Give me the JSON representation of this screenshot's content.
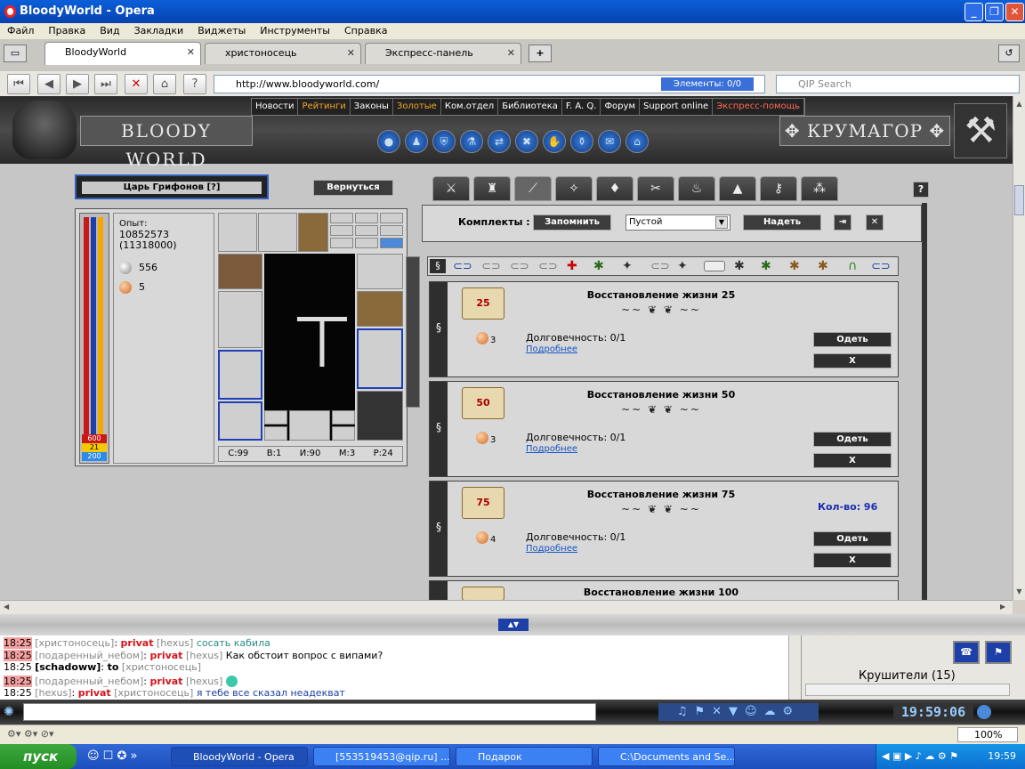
{
  "window": {
    "title": "BloodyWorld - Opera"
  },
  "menu": [
    "Файл",
    "Правка",
    "Вид",
    "Закладки",
    "Виджеты",
    "Инструменты",
    "Справка"
  ],
  "tabs": [
    {
      "label": "BloodyWorld"
    },
    {
      "label": "христоносець"
    },
    {
      "label": "Экспресс-панель"
    }
  ],
  "address": {
    "url": "http://www.bloodyworld.com/",
    "elements_label": "Элементы:",
    "elements_count": "0/0",
    "search_placeholder": "QIP Search"
  },
  "game": {
    "nav": [
      "Новости",
      "Рейтинги",
      "Законы",
      "Золотые",
      "Ком.отдел",
      "Библиотека",
      "F. A. Q.",
      "Форум",
      "Support online",
      "Экспресс-помощь"
    ],
    "logo_text": "BLOODY WORLD",
    "city": "КРУМАГОР",
    "char_name": "Царь Грифонов [?]",
    "back_button": "Вернуться",
    "exp_label": "Опыт:",
    "exp_value": "10852573",
    "exp_next": "(11318000)",
    "silver": "556",
    "copper": "5",
    "bar_hp": "600",
    "bar_mp": "21",
    "bar_en": "200",
    "stats": [
      "С:99",
      "В:1",
      "И:90",
      "М:3",
      "Р:24"
    ],
    "sets_label": "Комплекты :",
    "remember_button": "Запомнить",
    "set_select": "Пустой",
    "wear_set_button": "Надеть",
    "items": [
      {
        "name": "Восстановление жизни 25",
        "badge": "25",
        "price": "3",
        "durability": "Долговечность: 0/1",
        "more": "Подробнее",
        "qty": "",
        "wear": "Одеть",
        "del": "X"
      },
      {
        "name": "Восстановление жизни 50",
        "badge": "50",
        "price": "3",
        "durability": "Долговечность: 0/1",
        "more": "Подробнее",
        "qty": "",
        "wear": "Одеть",
        "del": "X"
      },
      {
        "name": "Восстановление жизни 75",
        "badge": "75",
        "price": "4",
        "durability": "Долговечность: 0/1",
        "more": "Подробнее",
        "qty": "Кол-во: 96",
        "wear": "Одеть",
        "del": "X"
      },
      {
        "name": "Восстановление жизни 100",
        "badge": "",
        "price": "",
        "durability": "",
        "more": "",
        "qty": "",
        "wear": "",
        "del": ""
      }
    ]
  },
  "chat": [
    {
      "time": "18:25",
      "hl": true,
      "user": "[христоносець]",
      "sep": ":",
      "kind": "privat",
      "target": "[hexus]",
      "msg": "сосать кабила"
    },
    {
      "time": "18:25",
      "hl": true,
      "user": "[подаренный_небом]",
      "sep": ":",
      "kind": "privat",
      "target": "[hexus]",
      "msg": "Как обстоит вопрос с випами?"
    },
    {
      "time": "18:25",
      "hl": false,
      "user": "[schadoww]",
      "sep": ":",
      "kind": "to",
      "target": "[христоносець]",
      "msg": ""
    },
    {
      "time": "18:25",
      "hl": true,
      "user": "[подаренный_небом]",
      "sep": ":",
      "kind": "privat",
      "target": "[hexus]",
      "msg": ""
    },
    {
      "time": "18:25",
      "hl": false,
      "user": "[hexus]",
      "sep": ":",
      "kind": "privat",
      "target": "[христоносець]",
      "msg": "я тебе все сказал неадекват"
    }
  ],
  "chat_side": "Крушители (15)",
  "clock": "19:59:06",
  "zoom": "100%",
  "taskbar": {
    "start": "пуск",
    "tasks": [
      "BloodyWorld - Opera",
      "[553519453@qip.ru] ...",
      "Подарок",
      "C:\\Documents and Se..."
    ],
    "time": "19:59"
  }
}
